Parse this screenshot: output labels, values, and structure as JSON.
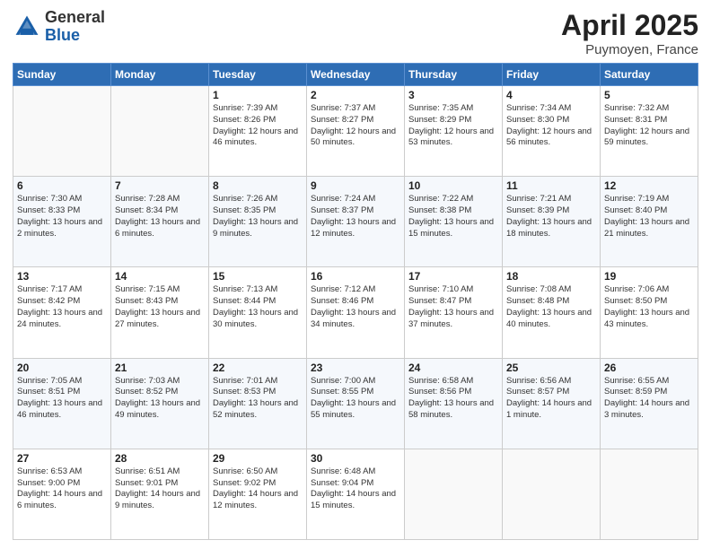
{
  "header": {
    "logo_general": "General",
    "logo_blue": "Blue",
    "title": "April 2025",
    "location": "Puymoyen, France"
  },
  "weekdays": [
    "Sunday",
    "Monday",
    "Tuesday",
    "Wednesday",
    "Thursday",
    "Friday",
    "Saturday"
  ],
  "weeks": [
    [
      {
        "day": "",
        "info": ""
      },
      {
        "day": "",
        "info": ""
      },
      {
        "day": "1",
        "info": "Sunrise: 7:39 AM\nSunset: 8:26 PM\nDaylight: 12 hours and 46 minutes."
      },
      {
        "day": "2",
        "info": "Sunrise: 7:37 AM\nSunset: 8:27 PM\nDaylight: 12 hours and 50 minutes."
      },
      {
        "day": "3",
        "info": "Sunrise: 7:35 AM\nSunset: 8:29 PM\nDaylight: 12 hours and 53 minutes."
      },
      {
        "day": "4",
        "info": "Sunrise: 7:34 AM\nSunset: 8:30 PM\nDaylight: 12 hours and 56 minutes."
      },
      {
        "day": "5",
        "info": "Sunrise: 7:32 AM\nSunset: 8:31 PM\nDaylight: 12 hours and 59 minutes."
      }
    ],
    [
      {
        "day": "6",
        "info": "Sunrise: 7:30 AM\nSunset: 8:33 PM\nDaylight: 13 hours and 2 minutes."
      },
      {
        "day": "7",
        "info": "Sunrise: 7:28 AM\nSunset: 8:34 PM\nDaylight: 13 hours and 6 minutes."
      },
      {
        "day": "8",
        "info": "Sunrise: 7:26 AM\nSunset: 8:35 PM\nDaylight: 13 hours and 9 minutes."
      },
      {
        "day": "9",
        "info": "Sunrise: 7:24 AM\nSunset: 8:37 PM\nDaylight: 13 hours and 12 minutes."
      },
      {
        "day": "10",
        "info": "Sunrise: 7:22 AM\nSunset: 8:38 PM\nDaylight: 13 hours and 15 minutes."
      },
      {
        "day": "11",
        "info": "Sunrise: 7:21 AM\nSunset: 8:39 PM\nDaylight: 13 hours and 18 minutes."
      },
      {
        "day": "12",
        "info": "Sunrise: 7:19 AM\nSunset: 8:40 PM\nDaylight: 13 hours and 21 minutes."
      }
    ],
    [
      {
        "day": "13",
        "info": "Sunrise: 7:17 AM\nSunset: 8:42 PM\nDaylight: 13 hours and 24 minutes."
      },
      {
        "day": "14",
        "info": "Sunrise: 7:15 AM\nSunset: 8:43 PM\nDaylight: 13 hours and 27 minutes."
      },
      {
        "day": "15",
        "info": "Sunrise: 7:13 AM\nSunset: 8:44 PM\nDaylight: 13 hours and 30 minutes."
      },
      {
        "day": "16",
        "info": "Sunrise: 7:12 AM\nSunset: 8:46 PM\nDaylight: 13 hours and 34 minutes."
      },
      {
        "day": "17",
        "info": "Sunrise: 7:10 AM\nSunset: 8:47 PM\nDaylight: 13 hours and 37 minutes."
      },
      {
        "day": "18",
        "info": "Sunrise: 7:08 AM\nSunset: 8:48 PM\nDaylight: 13 hours and 40 minutes."
      },
      {
        "day": "19",
        "info": "Sunrise: 7:06 AM\nSunset: 8:50 PM\nDaylight: 13 hours and 43 minutes."
      }
    ],
    [
      {
        "day": "20",
        "info": "Sunrise: 7:05 AM\nSunset: 8:51 PM\nDaylight: 13 hours and 46 minutes."
      },
      {
        "day": "21",
        "info": "Sunrise: 7:03 AM\nSunset: 8:52 PM\nDaylight: 13 hours and 49 minutes."
      },
      {
        "day": "22",
        "info": "Sunrise: 7:01 AM\nSunset: 8:53 PM\nDaylight: 13 hours and 52 minutes."
      },
      {
        "day": "23",
        "info": "Sunrise: 7:00 AM\nSunset: 8:55 PM\nDaylight: 13 hours and 55 minutes."
      },
      {
        "day": "24",
        "info": "Sunrise: 6:58 AM\nSunset: 8:56 PM\nDaylight: 13 hours and 58 minutes."
      },
      {
        "day": "25",
        "info": "Sunrise: 6:56 AM\nSunset: 8:57 PM\nDaylight: 14 hours and 1 minute."
      },
      {
        "day": "26",
        "info": "Sunrise: 6:55 AM\nSunset: 8:59 PM\nDaylight: 14 hours and 3 minutes."
      }
    ],
    [
      {
        "day": "27",
        "info": "Sunrise: 6:53 AM\nSunset: 9:00 PM\nDaylight: 14 hours and 6 minutes."
      },
      {
        "day": "28",
        "info": "Sunrise: 6:51 AM\nSunset: 9:01 PM\nDaylight: 14 hours and 9 minutes."
      },
      {
        "day": "29",
        "info": "Sunrise: 6:50 AM\nSunset: 9:02 PM\nDaylight: 14 hours and 12 minutes."
      },
      {
        "day": "30",
        "info": "Sunrise: 6:48 AM\nSunset: 9:04 PM\nDaylight: 14 hours and 15 minutes."
      },
      {
        "day": "",
        "info": ""
      },
      {
        "day": "",
        "info": ""
      },
      {
        "day": "",
        "info": ""
      }
    ]
  ]
}
